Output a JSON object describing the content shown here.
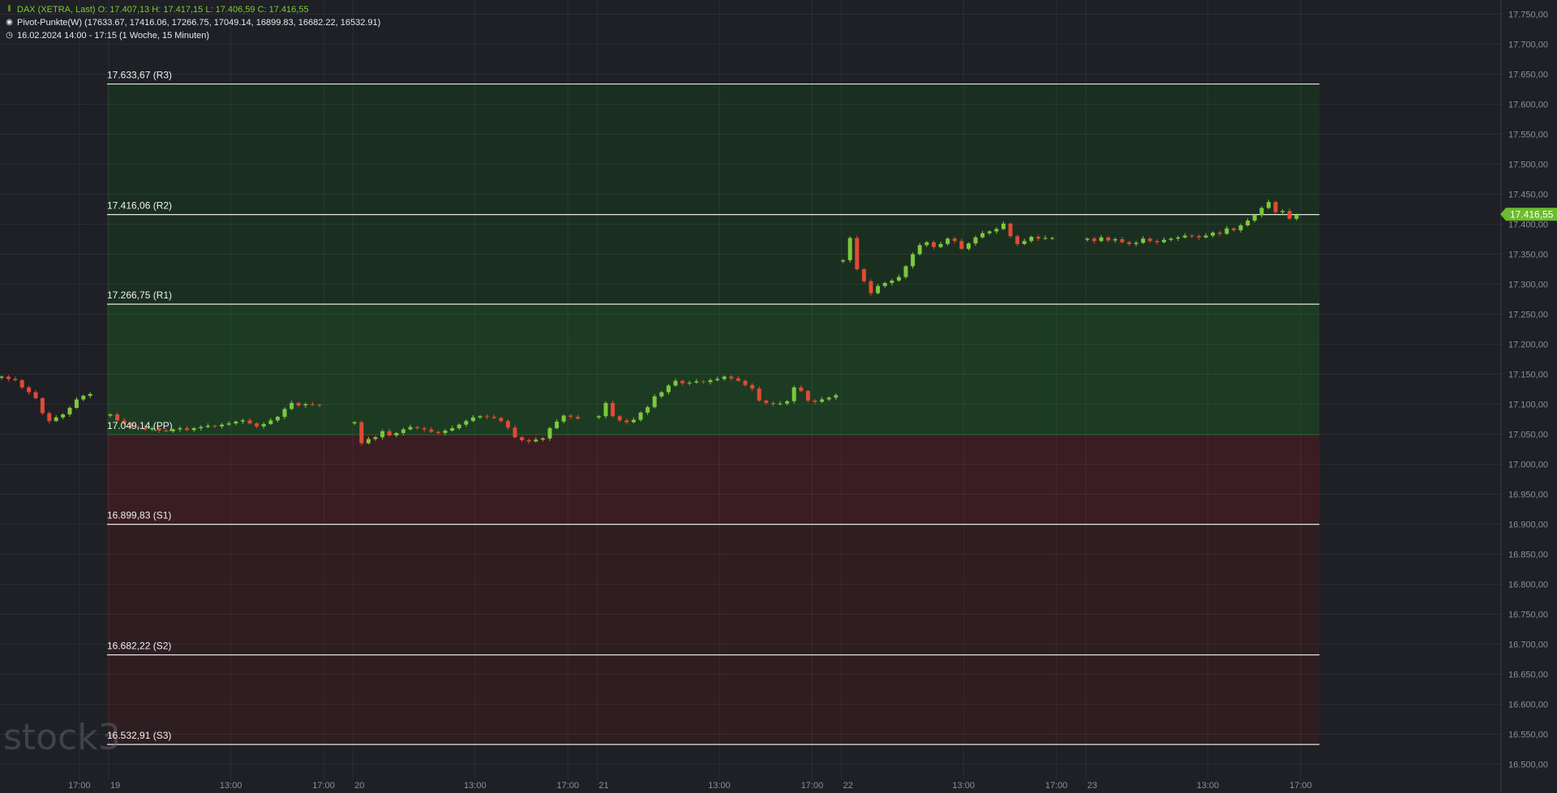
{
  "header": {
    "instrument_line": "DAX (XETRA, Last)  O: 17.407,13  H: 17.417,15  L: 17.406,59  C: 17.416,55",
    "indicator_line": "Pivot-Punkte(W)  (17633.67,  17416.06,  17266.75,  17049.14,  16899.83,  16682.22,  16532.91)",
    "period_line": "16.02.2024 14:00 - 17:15   (1 Woche, 15 Minuten)",
    "icons": [
      "candlestick-chart-icon",
      "indicator-dot-icon",
      "clock-icon"
    ]
  },
  "watermark": "stock3",
  "colors": {
    "background": "#1e2026",
    "up_candle": "#7cc83c",
    "down_candle": "#e04a35",
    "bull_zone": "#1c3b22",
    "bull_zone_upper": "#1b2f21",
    "bear_zone": "#3a1d22",
    "bear_zone_lower": "#2e1d21",
    "pivot_line": "#e6e6e6",
    "price_badge": "#6dbb2e"
  },
  "chart_data": {
    "type": "candlestick",
    "title": "DAX (XETRA, Last)",
    "timeframe": "15 Minuten",
    "last_price_label": "17.416,55",
    "last_price": 17416.55,
    "ohlc_last": {
      "open": 17407.13,
      "high": 17417.15,
      "low": 17406.59,
      "close": 17416.55
    },
    "ylim": [
      16490,
      17760
    ],
    "y_ticks": [
      16500,
      16550,
      16600,
      16650,
      16700,
      16750,
      16800,
      16850,
      16900,
      16950,
      17000,
      17050,
      17100,
      17150,
      17200,
      17250,
      17300,
      17350,
      17400,
      17450,
      17500,
      17550,
      17600,
      17650,
      17700,
      17750
    ],
    "y_tick_labels": [
      "16.500,00",
      "16.550,00",
      "16.600,00",
      "16.650,00",
      "16.700,00",
      "16.750,00",
      "16.800,00",
      "16.850,00",
      "16.900,00",
      "16.950,00",
      "17.000,00",
      "17.050,00",
      "17.100,00",
      "17.150,00",
      "17.200,00",
      "17.250,00",
      "17.300,00",
      "17.350,00",
      "17.400,00",
      "17.450,00",
      "17.500,00",
      "17.550,00",
      "17.600,00",
      "17.650,00",
      "17.700,00",
      "17.750,00"
    ],
    "x_ticks": [
      {
        "label": "17:00",
        "t": -0.12
      },
      {
        "label": "19",
        "t": 0
      },
      {
        "label": "13:00",
        "t": 0.5
      },
      {
        "label": "17:00",
        "t": 0.88
      },
      {
        "label": "20",
        "t": 1
      },
      {
        "label": "13:00",
        "t": 1.5
      },
      {
        "label": "17:00",
        "t": 1.88
      },
      {
        "label": "21",
        "t": 2
      },
      {
        "label": "13:00",
        "t": 2.5
      },
      {
        "label": "17:00",
        "t": 2.88
      },
      {
        "label": "22",
        "t": 3
      },
      {
        "label": "13:00",
        "t": 3.5
      },
      {
        "label": "17:00",
        "t": 3.88
      },
      {
        "label": "23",
        "t": 4
      },
      {
        "label": "13:00",
        "t": 4.5
      },
      {
        "label": "17:00",
        "t": 4.88
      }
    ],
    "pivots": [
      {
        "name": "R3",
        "value": 17633.67,
        "label": "17.633,67 (R3)"
      },
      {
        "name": "R2",
        "value": 17416.06,
        "label": "17.416,06 (R2)"
      },
      {
        "name": "R1",
        "value": 17266.75,
        "label": "17.266,75 (R1)"
      },
      {
        "name": "PP",
        "value": 17049.14,
        "label": "17.049,14 (PP)"
      },
      {
        "name": "S1",
        "value": 16899.83,
        "label": "16.899,83 (S1)"
      },
      {
        "name": "S2",
        "value": 16682.22,
        "label": "16.682,22 (S2)"
      },
      {
        "name": "S3",
        "value": 16532.91,
        "label": "16.532,91 (S3)"
      }
    ],
    "closes_prior_session": [
      17146,
      17142,
      17140,
      17128,
      17120,
      17110,
      17085,
      17072,
      17078,
      17083,
      17094,
      17108,
      17114,
      17117
    ],
    "closes": {
      "Mon 19": [
        17083,
        17073,
        17068,
        17062,
        17061,
        17058,
        17060,
        17056,
        17055,
        17058,
        17060,
        17057,
        17060,
        17062,
        17064,
        17063,
        17066,
        17068,
        17071,
        17073,
        17068,
        17063,
        17067,
        17073,
        17079,
        17092,
        17102,
        17098,
        17100,
        17099,
        17098
      ],
      "Tue 20": [
        17070,
        17035,
        17042,
        17045,
        17055,
        17048,
        17052,
        17058,
        17062,
        17060,
        17058,
        17054,
        17052,
        17056,
        17060,
        17066,
        17072,
        17078,
        17080,
        17079,
        17077,
        17072,
        17061,
        17045,
        17040,
        17038,
        17041,
        17043,
        17060,
        17071,
        17081,
        17079,
        17076
      ],
      "Wed 21": [
        17080,
        17102,
        17080,
        17073,
        17070,
        17074,
        17086,
        17095,
        17113,
        17120,
        17131,
        17139,
        17135,
        17136,
        17138,
        17137,
        17140,
        17142,
        17146,
        17143,
        17139,
        17132,
        17126,
        17106,
        17102,
        17100,
        17101,
        17105,
        17128,
        17122,
        17106,
        17104,
        17108,
        17111,
        17115
      ],
      "Thu 22": [
        17340,
        17377,
        17325,
        17305,
        17285,
        17297,
        17302,
        17306,
        17312,
        17330,
        17350,
        17365,
        17370,
        17362,
        17367,
        17376,
        17372,
        17359,
        17368,
        17378,
        17385,
        17388,
        17392,
        17401,
        17380,
        17367,
        17372,
        17379,
        17376,
        17377,
        17377
      ],
      "Fri 23": [
        17376,
        17372,
        17378,
        17373,
        17375,
        17370,
        17367,
        17369,
        17376,
        17372,
        17370,
        17374,
        17376,
        17378,
        17381,
        17380,
        17378,
        17381,
        17386,
        17384,
        17393,
        17390,
        17398,
        17406,
        17415,
        17427,
        17437,
        17420,
        17422,
        17409,
        17416
      ]
    }
  }
}
